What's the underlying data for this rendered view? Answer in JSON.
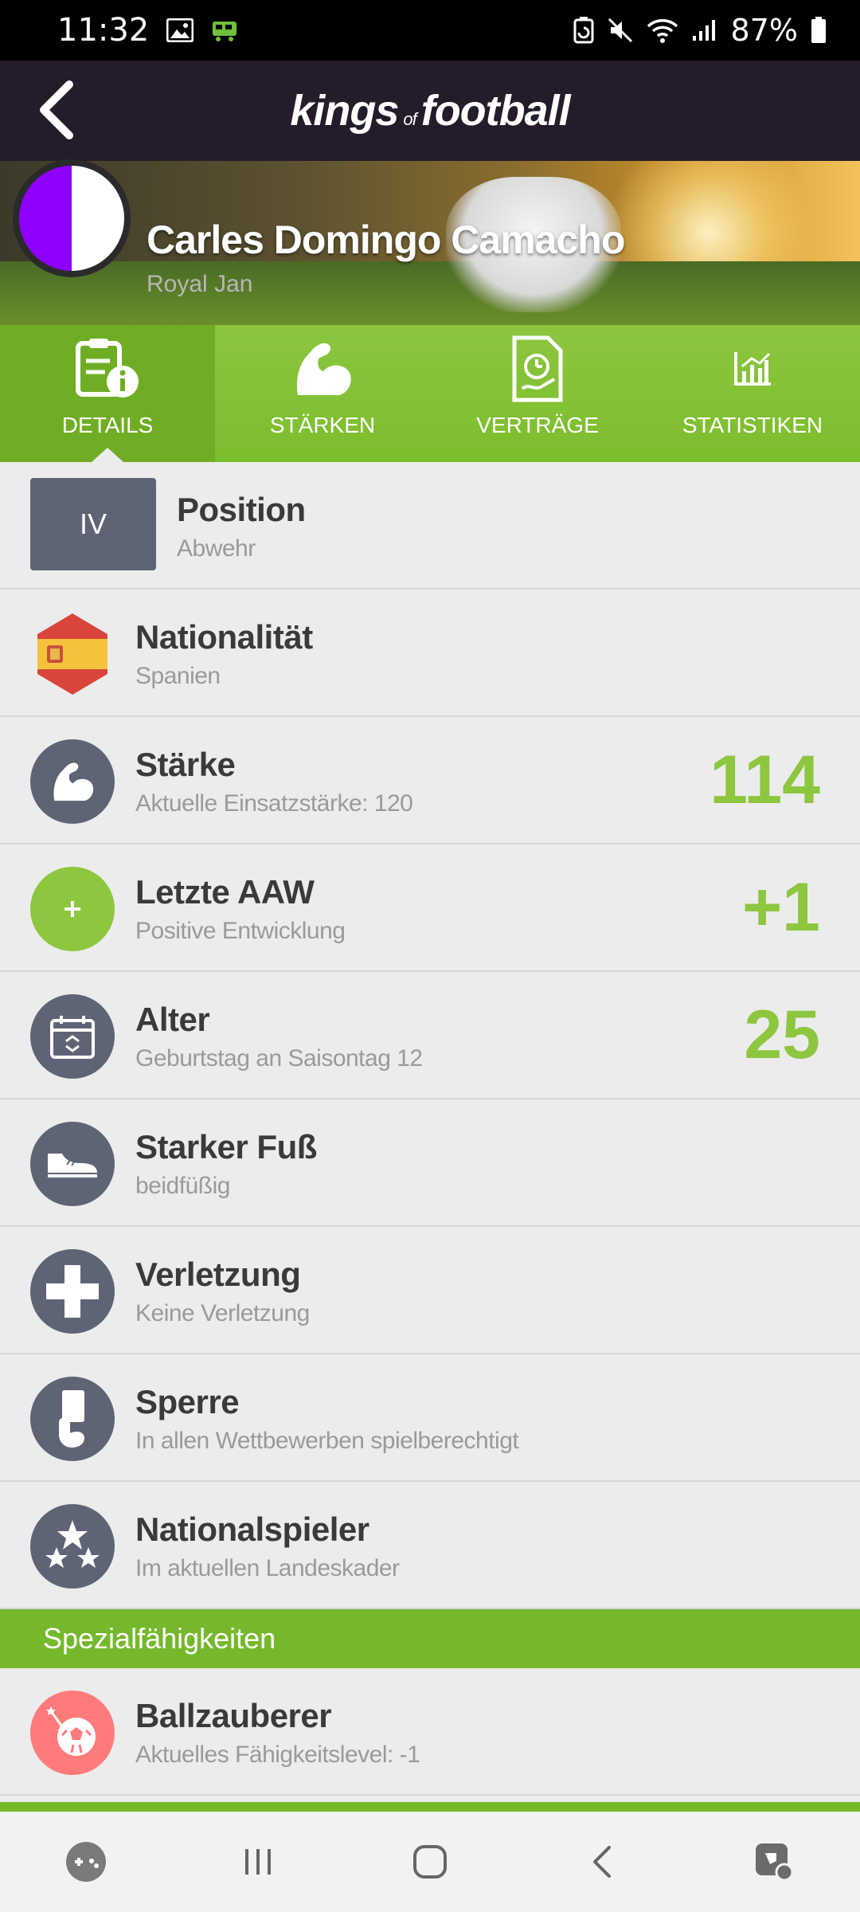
{
  "status_bar": {
    "time": "11:32",
    "battery": "87%",
    "icons": [
      "image-icon",
      "train-icon",
      "battery-saver-icon",
      "mute-icon",
      "wifi-icon",
      "signal-icon",
      "battery-icon"
    ]
  },
  "header": {
    "logo_main1": "kings",
    "logo_of": "of",
    "logo_main2": "football",
    "back_icon": "back-arrow-icon"
  },
  "player": {
    "name": "Carles Domingo Camacho",
    "club": "Royal Jan",
    "club_colors": [
      "#8e00ff",
      "#ffffff"
    ]
  },
  "tabs": [
    {
      "label": "DETAILS",
      "icon": "details-icon",
      "active": true
    },
    {
      "label": "STÄRKEN",
      "icon": "muscle-icon",
      "active": false
    },
    {
      "label": "VERTRÄGE",
      "icon": "contract-icon",
      "active": false
    },
    {
      "label": "STATISTIKEN",
      "icon": "chart-icon",
      "active": false
    }
  ],
  "details": {
    "position": {
      "badge": "IV",
      "title": "Position",
      "sub": "Abwehr"
    },
    "nationality": {
      "title": "Nationalität",
      "sub": "Spanien",
      "icon": "spain-flag-icon"
    },
    "strength": {
      "title": "Stärke",
      "sub": "Aktuelle Einsatzstärke: 120",
      "value": "114",
      "icon": "muscle-icon"
    },
    "last_aaw": {
      "title": "Letzte AAW",
      "sub": "Positive Entwicklung",
      "value": "+1",
      "icon": "plus-icon"
    },
    "age": {
      "title": "Alter",
      "sub": "Geburtstag an Saisontag 12",
      "value": "25",
      "icon": "calendar-icon"
    },
    "foot": {
      "title": "Starker Fuß",
      "sub": "beidfüßig",
      "icon": "boot-icon"
    },
    "injury": {
      "title": "Verletzung",
      "sub": "Keine Verletzung",
      "icon": "medical-cross-icon"
    },
    "suspension": {
      "title": "Sperre",
      "sub": "In allen Wettbewerben spielberechtigt",
      "icon": "card-icon"
    },
    "national": {
      "title": "Nationalspieler",
      "sub": "Im aktuellen Landeskader",
      "icon": "stars-icon"
    }
  },
  "special": {
    "header": "Spezialfähigkeiten",
    "skill": {
      "title": "Ballzauberer",
      "sub": "Aktuelles Fähigkeitslevel: -1",
      "icon": "magic-ball-icon"
    }
  },
  "colors": {
    "accent_green": "#8dc63f",
    "header_dark": "#241c2a",
    "icon_slate": "#5f6475",
    "skill_pink": "#ff7b7b"
  },
  "navbar": [
    "game-launcher-icon",
    "recents-icon",
    "home-icon",
    "back-icon",
    "assistant-icon"
  ]
}
